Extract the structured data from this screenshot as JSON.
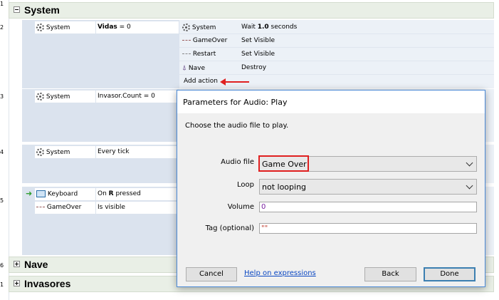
{
  "line_numbers": [
    "1",
    "2",
    "3",
    "4",
    "5",
    "6",
    "1"
  ],
  "groups": {
    "system": "System",
    "nave": "Nave",
    "invasores": "Invasores"
  },
  "events": {
    "e2": {
      "condition": {
        "object": "System",
        "text_bold": "Vidas",
        "text_rest": " = 0"
      },
      "actions": [
        {
          "icon": "gear-icon",
          "object": "System",
          "text_pre": "Wait ",
          "text_bold": "1.0",
          "text_post": " seconds"
        },
        {
          "icon": "gameover-icon",
          "object": "GameOver",
          "text": "Set Visible"
        },
        {
          "icon": "restart-icon",
          "object": "Restart",
          "text": "Set Visible"
        },
        {
          "icon": "ship-icon",
          "object": "Nave",
          "text": "Destroy"
        }
      ],
      "add_action": "Add action"
    },
    "e3": {
      "condition": {
        "object": "System",
        "text": "Invasor.Count = 0"
      }
    },
    "e4": {
      "condition": {
        "object": "System",
        "text": "Every tick"
      }
    },
    "e5": {
      "conditions": [
        {
          "object": "Keyboard",
          "text_pre": "On ",
          "text_bold": "R",
          "text_post": " pressed"
        },
        {
          "object": "GameOver",
          "text": "Is visible"
        }
      ]
    }
  },
  "dialog": {
    "title": "Parameters for Audio: Play",
    "description": "Choose the audio file to play.",
    "fields": {
      "audio_file": {
        "label": "Audio file",
        "value": "Game Over"
      },
      "loop": {
        "label": "Loop",
        "value": "not looping"
      },
      "volume": {
        "label": "Volume",
        "value": "0"
      },
      "tag": {
        "label": "Tag (optional)",
        "value": "\"\""
      }
    },
    "buttons": {
      "cancel": "Cancel",
      "help": "Help on expressions",
      "back": "Back",
      "done": "Done"
    }
  },
  "colors": {
    "annotation": "#e02020",
    "link": "#0a47c2",
    "dialog_border": "#4a89d6"
  }
}
